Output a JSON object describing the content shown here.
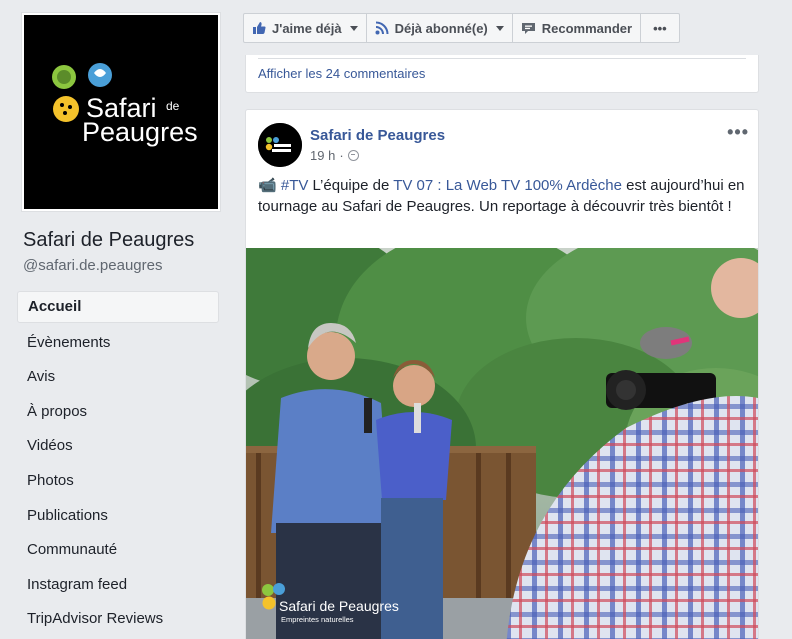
{
  "page": {
    "name": "Safari de Peaugres",
    "handle": "@safari.de.peaugres",
    "logo": {
      "line1": "Safari",
      "line1_small": "de",
      "line2": "Peaugres"
    }
  },
  "nav": {
    "items": [
      {
        "label": "Accueil"
      },
      {
        "label": "Évènements"
      },
      {
        "label": "Avis"
      },
      {
        "label": "À propos"
      },
      {
        "label": "Vidéos"
      },
      {
        "label": "Photos"
      },
      {
        "label": "Publications"
      },
      {
        "label": "Communauté"
      },
      {
        "label": "Instagram feed"
      },
      {
        "label": "TripAdvisor Reviews"
      }
    ]
  },
  "actions": {
    "like_label": "J'aime déjà",
    "follow_label": "Déjà abonné(e)",
    "recommend_label": "Recommander",
    "more_label": "•••"
  },
  "previous": {
    "comments_link": "Afficher les 24 commentaires"
  },
  "post": {
    "author": "Safari de Peaugres",
    "time": "19 h",
    "dot": "·",
    "more_label": "•••",
    "text_icon": "📹",
    "hashtag": "#TV",
    "text_1": " L’équipe de ",
    "mention": "TV 07 : La Web TV 100% Ardèche",
    "text_2": " est aujourd’hui en tournage au Safari de Peaugres. Un reportage à découvrir très bientôt !",
    "watermark_brand": "Safari de Peaugres",
    "watermark_tagline": "Empreintes naturelles"
  },
  "colors": {
    "link": "#385898",
    "accent_yellow": "#f4c22b",
    "accent_green": "#8cc63f",
    "accent_blue": "#4a9fd8"
  }
}
